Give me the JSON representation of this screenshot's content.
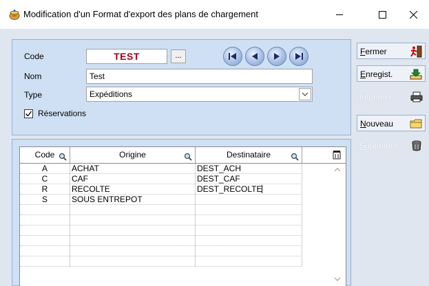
{
  "window": {
    "title": "Modification d'un Format d'export des plans de chargement",
    "icon": "app-pot-icon"
  },
  "form": {
    "code_label": "Code",
    "code_value": "TEST",
    "ellipsis_label": "...",
    "nom_label": "Nom",
    "nom_value": "Test",
    "type_label": "Type",
    "type_value": "Expéditions",
    "reservations_label": "Réservations",
    "reservations_checked": true
  },
  "nav": [
    "first-record-icon",
    "previous-record-icon",
    "next-record-icon",
    "last-record-icon"
  ],
  "grid": {
    "headers": {
      "code": "Code",
      "origine": "Origine",
      "destinataire": "Destinataire"
    },
    "rows": [
      {
        "code": "A",
        "origine": "ACHAT",
        "destinataire": "DEST_ACH"
      },
      {
        "code": "C",
        "origine": "CAF",
        "destinataire": "DEST_CAF"
      },
      {
        "code": "R",
        "origine": "RECOLTE",
        "destinataire": "DEST_RECOLTE"
      },
      {
        "code": "S",
        "origine": "SOUS ENTREPOT",
        "destinataire": ""
      },
      {
        "code": "",
        "origine": "",
        "destinataire": ""
      },
      {
        "code": "",
        "origine": "",
        "destinataire": ""
      },
      {
        "code": "",
        "origine": "",
        "destinataire": ""
      },
      {
        "code": "",
        "origine": "",
        "destinataire": ""
      },
      {
        "code": "",
        "origine": "",
        "destinataire": ""
      },
      {
        "code": "",
        "origine": "",
        "destinataire": ""
      }
    ]
  },
  "actions": {
    "fermer": {
      "first": "F",
      "rest": "ermer",
      "enabled": true,
      "icon": "exit-runner-icon"
    },
    "enregistrer": {
      "first": "E",
      "rest": "nregist.",
      "enabled": true,
      "icon": "save-tray-icon"
    },
    "imprimer": {
      "first": "I",
      "rest": "mprimer",
      "enabled": false,
      "icon": "printer-icon"
    },
    "nouveau": {
      "first": "N",
      "rest": "ouveau",
      "enabled": true,
      "icon": "new-folder-icon"
    },
    "supprimer": {
      "first": "S",
      "rest": "upprimer",
      "enabled": false,
      "icon": "trash-bin-icon"
    }
  },
  "colors": {
    "panel": "#cfe0f4",
    "code_text": "#a00020",
    "background": "#dfe6f0"
  }
}
